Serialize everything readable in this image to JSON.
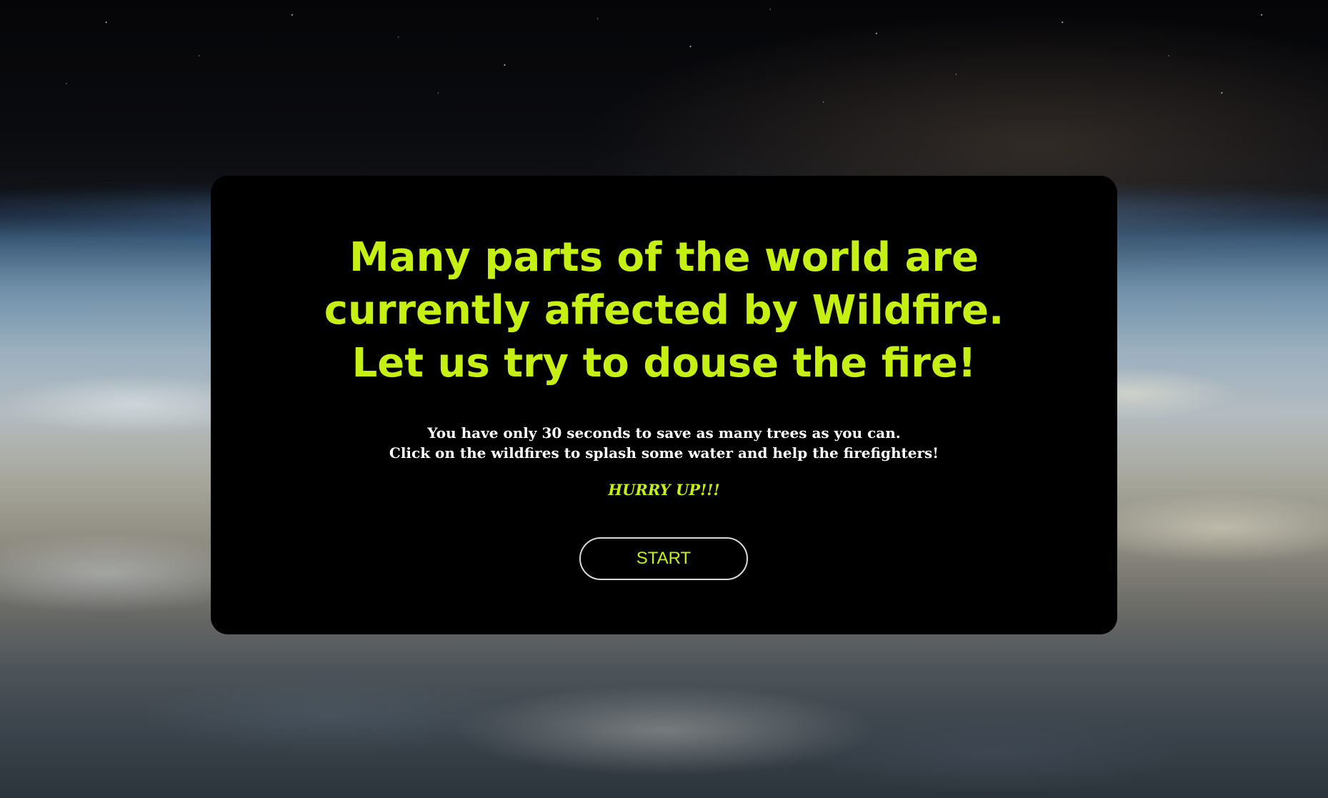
{
  "intro": {
    "title_lines": [
      "Many parts of the world are",
      "currently affected by Wildfire.",
      "Let us try to douse the fire!"
    ],
    "instruction_lines": [
      "You have only 30 seconds to save as many trees as you can.",
      "Click on the wildfires to splash some water and help the firefighters!"
    ],
    "hurry_text": "HURRY UP!!!",
    "start_label": "START"
  },
  "colors": {
    "accent": "#c6f014",
    "card_background": "#000000",
    "text": "#ffffff"
  }
}
